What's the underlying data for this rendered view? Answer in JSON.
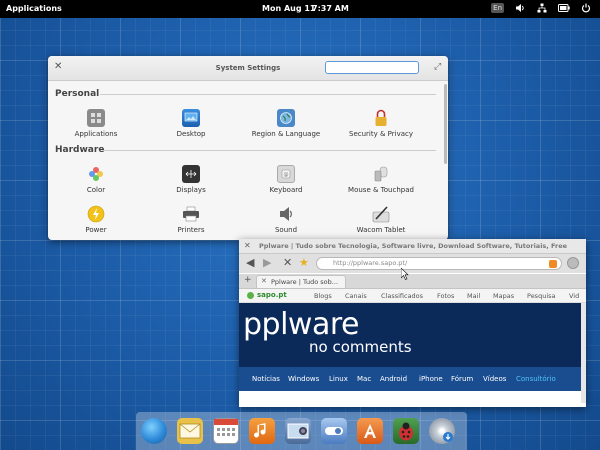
{
  "panel": {
    "applications_label": "Applications",
    "date": "Mon Aug 11",
    "time": "7:37 AM",
    "keyboard_layout": "En"
  },
  "settings_window": {
    "title": "System Settings",
    "search_value": "",
    "sections": [
      {
        "label": "Personal",
        "items": [
          {
            "label": "Applications",
            "icon": "applications-icon"
          },
          {
            "label": "Desktop",
            "icon": "desktop-icon"
          },
          {
            "label": "Region & Language",
            "icon": "region-language-icon"
          },
          {
            "label": "Security & Privacy",
            "icon": "lock-icon"
          }
        ]
      },
      {
        "label": "Hardware",
        "items": [
          {
            "label": "Color",
            "icon": "color-icon"
          },
          {
            "label": "Displays",
            "icon": "displays-icon"
          },
          {
            "label": "Keyboard",
            "icon": "keyboard-icon"
          },
          {
            "label": "Mouse & Touchpad",
            "icon": "mouse-icon"
          },
          {
            "label": "Power",
            "icon": "power-icon"
          },
          {
            "label": "Printers",
            "icon": "printer-icon"
          },
          {
            "label": "Sound",
            "icon": "speaker-icon"
          },
          {
            "label": "Wacom Tablet",
            "icon": "tablet-icon"
          }
        ]
      }
    ]
  },
  "browser_window": {
    "title": "Pplware | Tudo sobre Tecnologia, Software livre, Download Software, Tutoriais, Free So...",
    "url": "http://pplware.sapo.pt/",
    "tab_label": "Pplware | Tudo sob...",
    "sapo_logo": "sapo.pt",
    "sapo_nav": [
      "Blogs",
      "Canais",
      "Classificados",
      "Fotos",
      "Mail",
      "Mapas",
      "Pesquisa",
      "Vid"
    ],
    "site_logo_main": "pplware",
    "site_logo_sub": "no comments",
    "site_nav": [
      "Notícias",
      "Windows",
      "Linux",
      "Mac",
      "Android",
      "iPhone",
      "Fórum",
      "Vídeos",
      "Consultório"
    ],
    "site_nav_active_color": "#4fc3f7"
  },
  "dock": {
    "items": [
      {
        "name": "web-browser-icon",
        "color": "#2e8ad8"
      },
      {
        "name": "mail-icon",
        "color": "#e8c14a"
      },
      {
        "name": "calendar-icon",
        "color": "#d94a3a"
      },
      {
        "name": "music-icon",
        "color": "#f07a1a"
      },
      {
        "name": "photos-icon",
        "color": "#5a7aa8"
      },
      {
        "name": "system-settings-icon",
        "color": "#5a8ad0"
      },
      {
        "name": "app-center-icon",
        "color": "#e8702a"
      },
      {
        "name": "bug-icon",
        "color": "#c03030"
      },
      {
        "name": "disc-install-icon",
        "color": "#c8d0d8"
      }
    ]
  }
}
